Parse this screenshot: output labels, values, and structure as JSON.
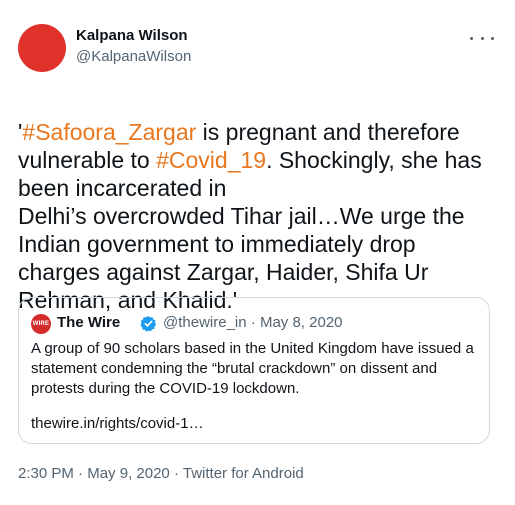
{
  "author": {
    "name": "Kalpana Wilson",
    "handle": "@KalpanaWilson"
  },
  "tweet": {
    "parts": [
      {
        "text": "'",
        "type": "text"
      },
      {
        "text": "#Safoora_Zargar",
        "type": "hashtag"
      },
      {
        "text": " is pregnant and therefore vulnerable to ",
        "type": "text"
      },
      {
        "text": "#Covid_19",
        "type": "hashtag"
      },
      {
        "text": ". Shockingly, she has been incarcerated in\nDelhi’s  overcrowded Tihar jail…We urge the Indian government to immediately drop charges against Zargar, Haider, Shifa Ur Rehman, and Khalid.'",
        "type": "text"
      }
    ]
  },
  "quote": {
    "logo_text": "WIRE",
    "name": "The Wire",
    "handle": "@thewire_in",
    "separator": "·",
    "date": "May 8, 2020",
    "text": "A group of 90 scholars based in the United Kingdom have issued a statement condemning the “brutal crackdown” on dissent and protests during the COVID-19 lockdown.",
    "link": "thewire.in/rights/covid-1…"
  },
  "footer": {
    "time": "2:30 PM",
    "date": "May 9, 2020",
    "source": "Twitter for Android",
    "separator": "·"
  },
  "colors": {
    "hashtag": "#e8771f",
    "avatar": "#e0312b",
    "verified": "#1d9bf0"
  }
}
